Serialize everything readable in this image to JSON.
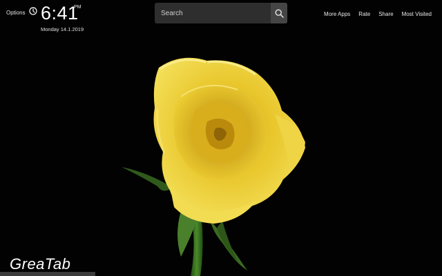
{
  "header": {
    "options_label": "Options",
    "time": "6:41",
    "ampm": "PM",
    "date": "Monday 14.1.2019"
  },
  "search": {
    "placeholder": "Search"
  },
  "nav": {
    "items": [
      "More Apps",
      "Rate",
      "Share",
      "Most Visited"
    ]
  },
  "brand": {
    "logo_text": "GreaTab"
  },
  "icons": {
    "clock": "clock-icon",
    "search": "search-icon"
  },
  "colors": {
    "background": "#000000",
    "search_box": "#2e2e2e",
    "search_button": "#454545",
    "rose_yellow": "#f2d640"
  }
}
